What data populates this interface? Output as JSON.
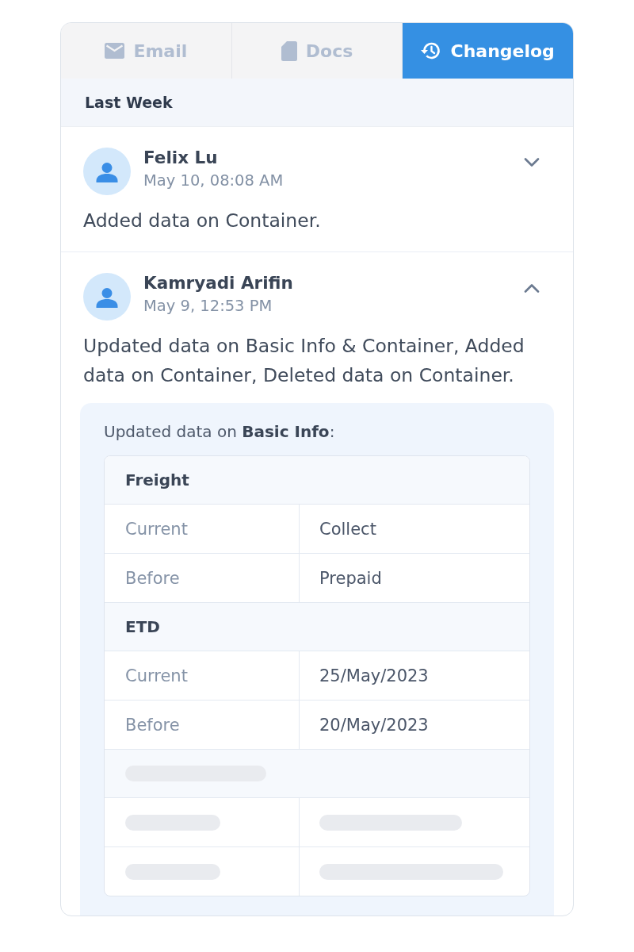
{
  "tabs": [
    {
      "label": "Email",
      "selected": false
    },
    {
      "label": "Docs",
      "selected": false
    },
    {
      "label": "Changelog",
      "selected": true
    }
  ],
  "section": {
    "title": "Last Week"
  },
  "entries": [
    {
      "name": "Felix Lu",
      "time": "May 10, 08:08 AM",
      "summary": "Added data on Container.",
      "expanded": false
    },
    {
      "name": "Kamryadi Arifin",
      "time": "May 9, 12:53 PM",
      "summary": "Updated data on Basic Info & Container, Added data on Container, Deleted data on Container.",
      "expanded": true,
      "details": {
        "title": "Updated data on **Basic Info**:",
        "groups": [
          {
            "kind": "field",
            "title": "Freight",
            "rows": [
              {
                "label": "Current",
                "value": "Collect"
              },
              {
                "label": "Before",
                "value": "Prepaid"
              }
            ]
          },
          {
            "kind": "field",
            "title": "ETD",
            "rows": [
              {
                "label": "Current",
                "value": "25/May/2023"
              },
              {
                "label": "Before",
                "value": "20/May/2023"
              }
            ]
          },
          {
            "kind": "loading"
          }
        ]
      }
    }
  ]
}
